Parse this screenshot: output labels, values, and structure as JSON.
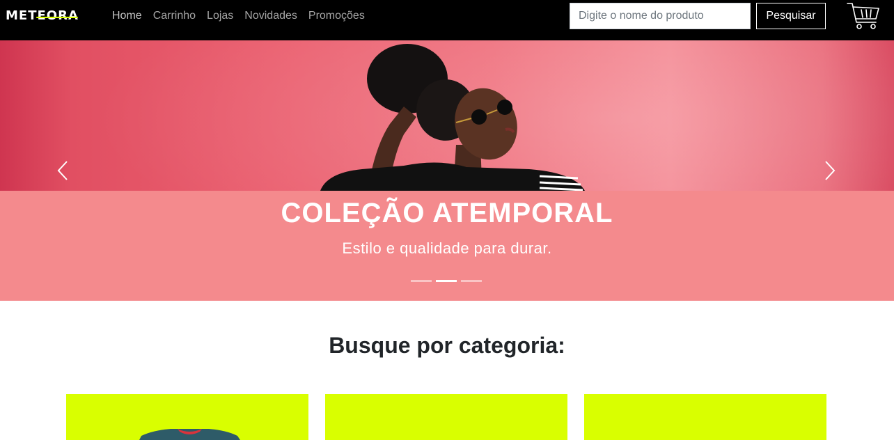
{
  "navbar": {
    "logo_text": "METEORA",
    "links": [
      "Home",
      "Carrinho",
      "Lojas",
      "Novidades",
      "Promoções"
    ],
    "search": {
      "placeholder": "Digite o nome do produto",
      "value": ""
    },
    "search_button": "Pesquisar",
    "cart_icon": "shopping-cart-icon"
  },
  "hero": {
    "title": "COLEÇÃO ATEMPORAL",
    "subtitle": "Estilo e qualidade para durar.",
    "slide_count": 3,
    "active_slide": 2,
    "prev_icon": "chevron-left-icon",
    "next_icon": "chevron-right-icon"
  },
  "categories": {
    "heading": "Busque por categoria:"
  },
  "colors": {
    "navbar_bg": "#000000",
    "accent": "#d9ff00",
    "hero_caption_bg": "#f48a8d"
  }
}
